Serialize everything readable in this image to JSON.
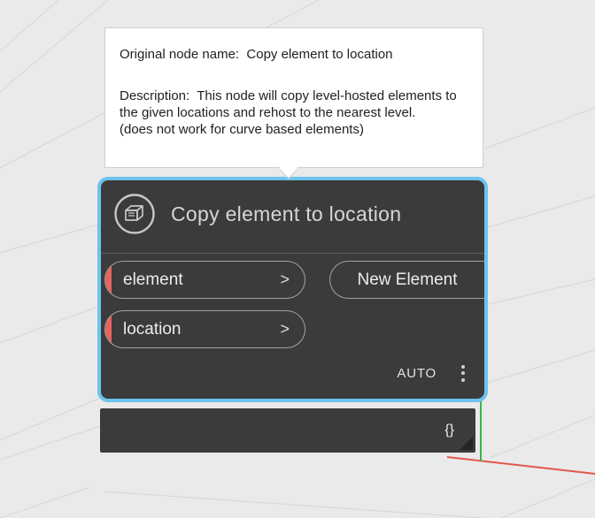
{
  "tooltip": {
    "original_line": "Original node name:  Copy element to location",
    "description_line": "Description:  This node will copy level-hosted elements to the given locations and rehost to the nearest level.\n(does not work for curve based elements)"
  },
  "node": {
    "title": "Copy element to location",
    "inputs": [
      {
        "label": "element",
        "chevron": ">"
      },
      {
        "label": "location",
        "chevron": ">"
      }
    ],
    "output": {
      "label": "New Element"
    },
    "lacing_label": "AUTO"
  },
  "preview": {
    "value": "{}"
  },
  "colors": {
    "selection": "#6cc4ec",
    "node_bg": "#3b3b3b",
    "port_accent": "#e8645f",
    "pill_border": "#a3a3a3",
    "axis_green": "#3cb54a",
    "axis_red": "#e2574c",
    "canvas_bg": "#eaeaea",
    "grid_line": "#d6d6d6",
    "tooltip_border": "#cfcfcf"
  }
}
